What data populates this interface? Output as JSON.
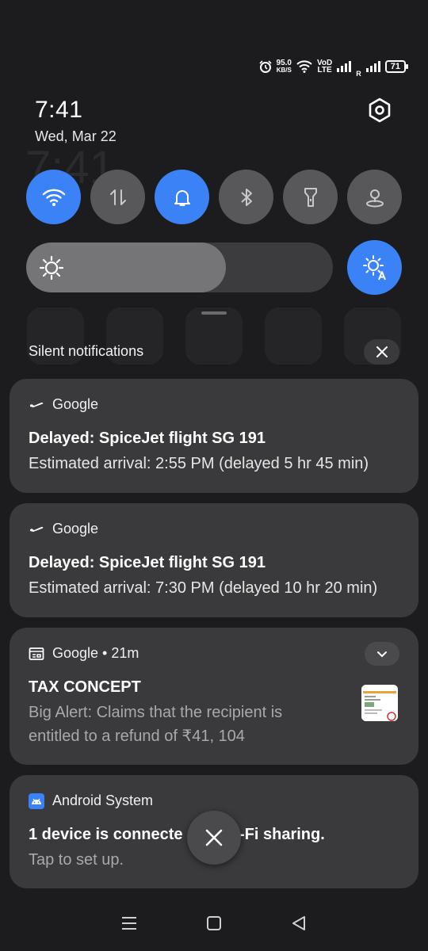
{
  "status_bar": {
    "net_speed_value": "95.0",
    "net_speed_unit": "KB/S",
    "volte_top": "VoD",
    "volte_bottom": "LTE",
    "roaming": "R",
    "battery": "71"
  },
  "header": {
    "time": "7:41",
    "date": "Wed, Mar 22"
  },
  "quick_settings": {
    "tiles": [
      {
        "name": "wifi",
        "active": true
      },
      {
        "name": "mobile-data",
        "active": false
      },
      {
        "name": "sound",
        "active": true
      },
      {
        "name": "bluetooth",
        "active": false
      },
      {
        "name": "flashlight",
        "active": false
      },
      {
        "name": "location",
        "active": false
      }
    ],
    "brightness_level": 0.65,
    "auto_brightness_active": true
  },
  "notifications": {
    "section_title": "Silent notifications",
    "items": [
      {
        "app": "Google",
        "icon": "flight-takeoff-icon",
        "title": "Delayed: SpiceJet flight SG 191",
        "body": "Estimated arrival: 2:55 PM (delayed 5 hr 45 min)"
      },
      {
        "app": "Google",
        "icon": "flight-takeoff-icon",
        "title": "Delayed: SpiceJet flight SG 191",
        "body": "Estimated arrival: 7:30 PM (delayed 10 hr 20 min)"
      },
      {
        "app": "Google • 21m",
        "icon": "news-icon",
        "title": "TAX CONCEPT",
        "body_line1": "Big Alert: Claims that the recipient is",
        "body_line2": "entitled to a refund of ₹41, 104"
      },
      {
        "app": "Android System",
        "icon": "android-icon",
        "title_left": "1 device is connecte",
        "title_right": "-Fi sharing.",
        "body": "Tap to set up."
      }
    ]
  },
  "colors": {
    "accent": "#3b82f6",
    "card": "#3a3a3c",
    "background": "#1c1c1e"
  }
}
